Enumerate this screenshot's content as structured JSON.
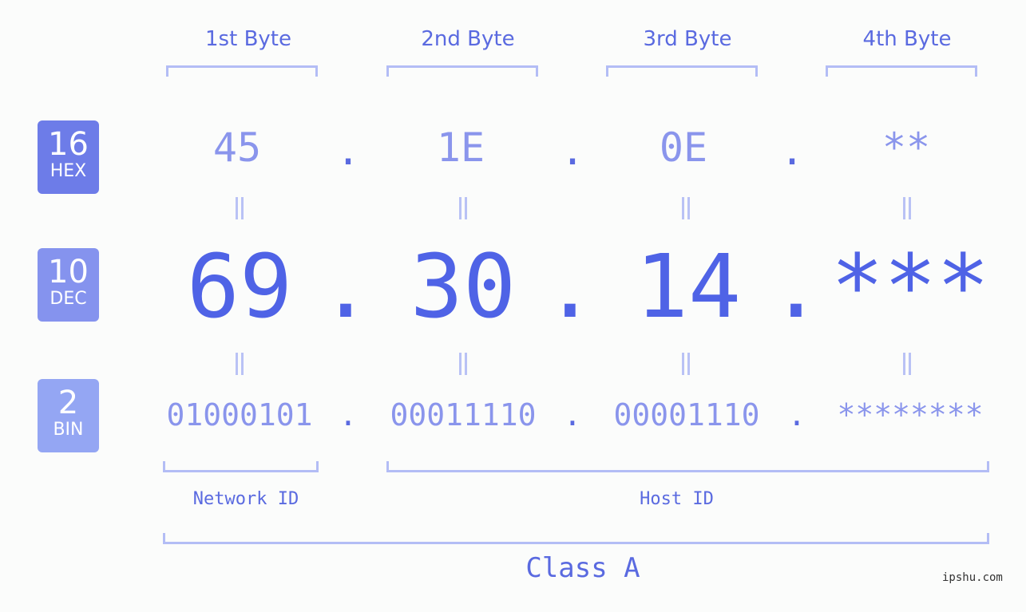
{
  "bytes": [
    {
      "header": "1st Byte",
      "hex": "45",
      "dec": "69",
      "bin": "01000101"
    },
    {
      "header": "2nd Byte",
      "hex": "1E",
      "dec": "30",
      "bin": "00011110"
    },
    {
      "header": "3rd Byte",
      "hex": "0E",
      "dec": "14",
      "bin": "00001110"
    },
    {
      "header": "4th Byte",
      "hex": "**",
      "dec": "***",
      "bin": "********"
    }
  ],
  "badges": {
    "hex": {
      "number": "16",
      "label": "HEX",
      "color": "#6d7ce8"
    },
    "dec": {
      "number": "10",
      "label": "DEC",
      "color": "#8593ee"
    },
    "bin": {
      "number": "2",
      "label": "BIN",
      "color": "#94a6f3"
    }
  },
  "separator": ".",
  "labels": {
    "network_id": "Network ID",
    "host_id": "Host ID",
    "class": "Class A"
  },
  "watermark": "ipshu.com"
}
